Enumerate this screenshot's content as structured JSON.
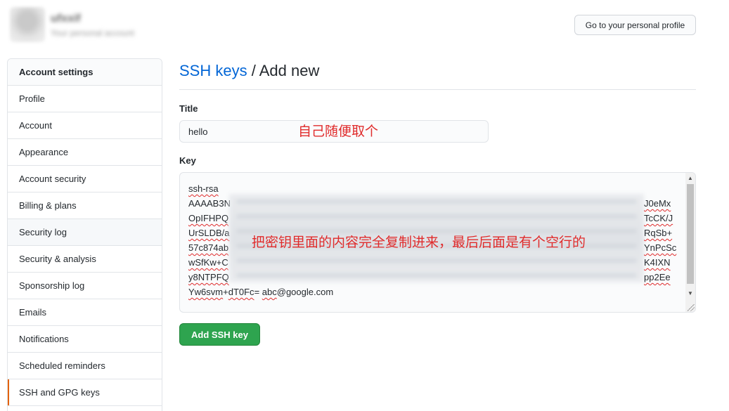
{
  "header": {
    "username": "ufxxif",
    "subtitle": "Your personal account",
    "profile_button": "Go to your personal profile"
  },
  "sidebar": {
    "title": "Account settings",
    "items": [
      {
        "label": "Profile"
      },
      {
        "label": "Account"
      },
      {
        "label": "Appearance"
      },
      {
        "label": "Account security"
      },
      {
        "label": "Billing & plans"
      },
      {
        "label": "Security log"
      },
      {
        "label": "Security & analysis"
      },
      {
        "label": "Sponsorship log"
      },
      {
        "label": "Emails"
      },
      {
        "label": "Notifications"
      },
      {
        "label": "Scheduled reminders"
      },
      {
        "label": "SSH and GPG keys"
      }
    ],
    "hovered_item": "Security log",
    "selected_item": "SSH and GPG keys"
  },
  "main": {
    "breadcrumb_link": "SSH keys",
    "breadcrumb_separator": " / ",
    "page_title": "Add new",
    "title_label": "Title",
    "title_value": "hello",
    "title_annotation": "自己随便取个",
    "key_label": "Key",
    "key_line_1": "ssh-rsa",
    "key_line_starts": [
      "AAAAB3N",
      "OpIFHPQ",
      "UrSLDB/a",
      "57c874ab",
      "wSfKw+C",
      "y8NTPFQ"
    ],
    "key_line_ends": [
      "J0eMx",
      "TcCK/J",
      "RqSb+",
      "YnPcSc",
      "K4IXN",
      "pp2Ee"
    ],
    "key_last_line_parts": [
      "Yw6svm",
      "+",
      "dT0Fc",
      "= ",
      "abc",
      "@google.com"
    ],
    "key_annotation": "把密钥里面的内容完全复制进来，最后后面是有个空行的",
    "submit_button": "Add SSH key"
  },
  "colors": {
    "link": "#0366d6",
    "primary_button": "#2ea44f",
    "annotation": "#e02b2b",
    "selected_indicator": "#e36209"
  }
}
